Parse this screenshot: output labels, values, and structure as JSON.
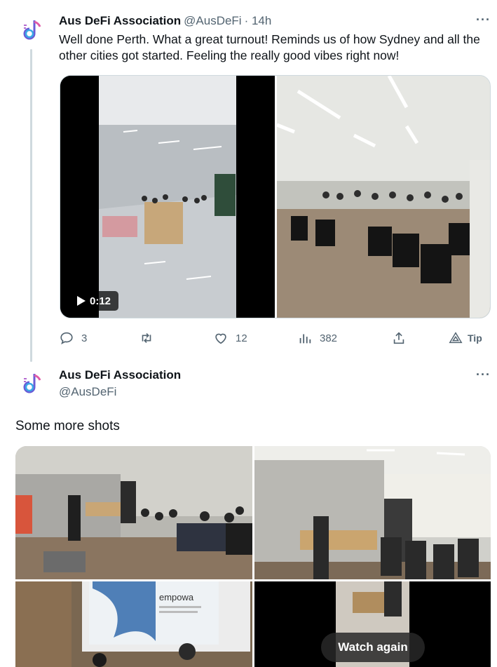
{
  "tweet1": {
    "name": "Aus DeFi Association",
    "handle": "@AusDeFi",
    "time": "· 14h",
    "more": "···",
    "text": "Well done Perth. What a great turnout! Reminds us of how Sydney and all the other cities got started. Feeling the really good vibes right now!",
    "video_duration": "0:12",
    "actions": {
      "replies": "3",
      "retweets": "",
      "likes": "12",
      "views": "382",
      "tip": "Tip"
    }
  },
  "tweet2": {
    "name": "Aus DeFi Association",
    "handle": "@AusDeFi",
    "more": "···",
    "text": "Some more shots",
    "video_overlay": "Watch again",
    "slide_brand": "empowa"
  },
  "icons": [
    "reply-icon",
    "retweet-icon",
    "like-icon",
    "views-icon",
    "share-icon",
    "tip-icon",
    "play-icon"
  ],
  "colors": {
    "text": "#0f1419",
    "secondary": "#536471",
    "thread": "#cfd9de"
  }
}
